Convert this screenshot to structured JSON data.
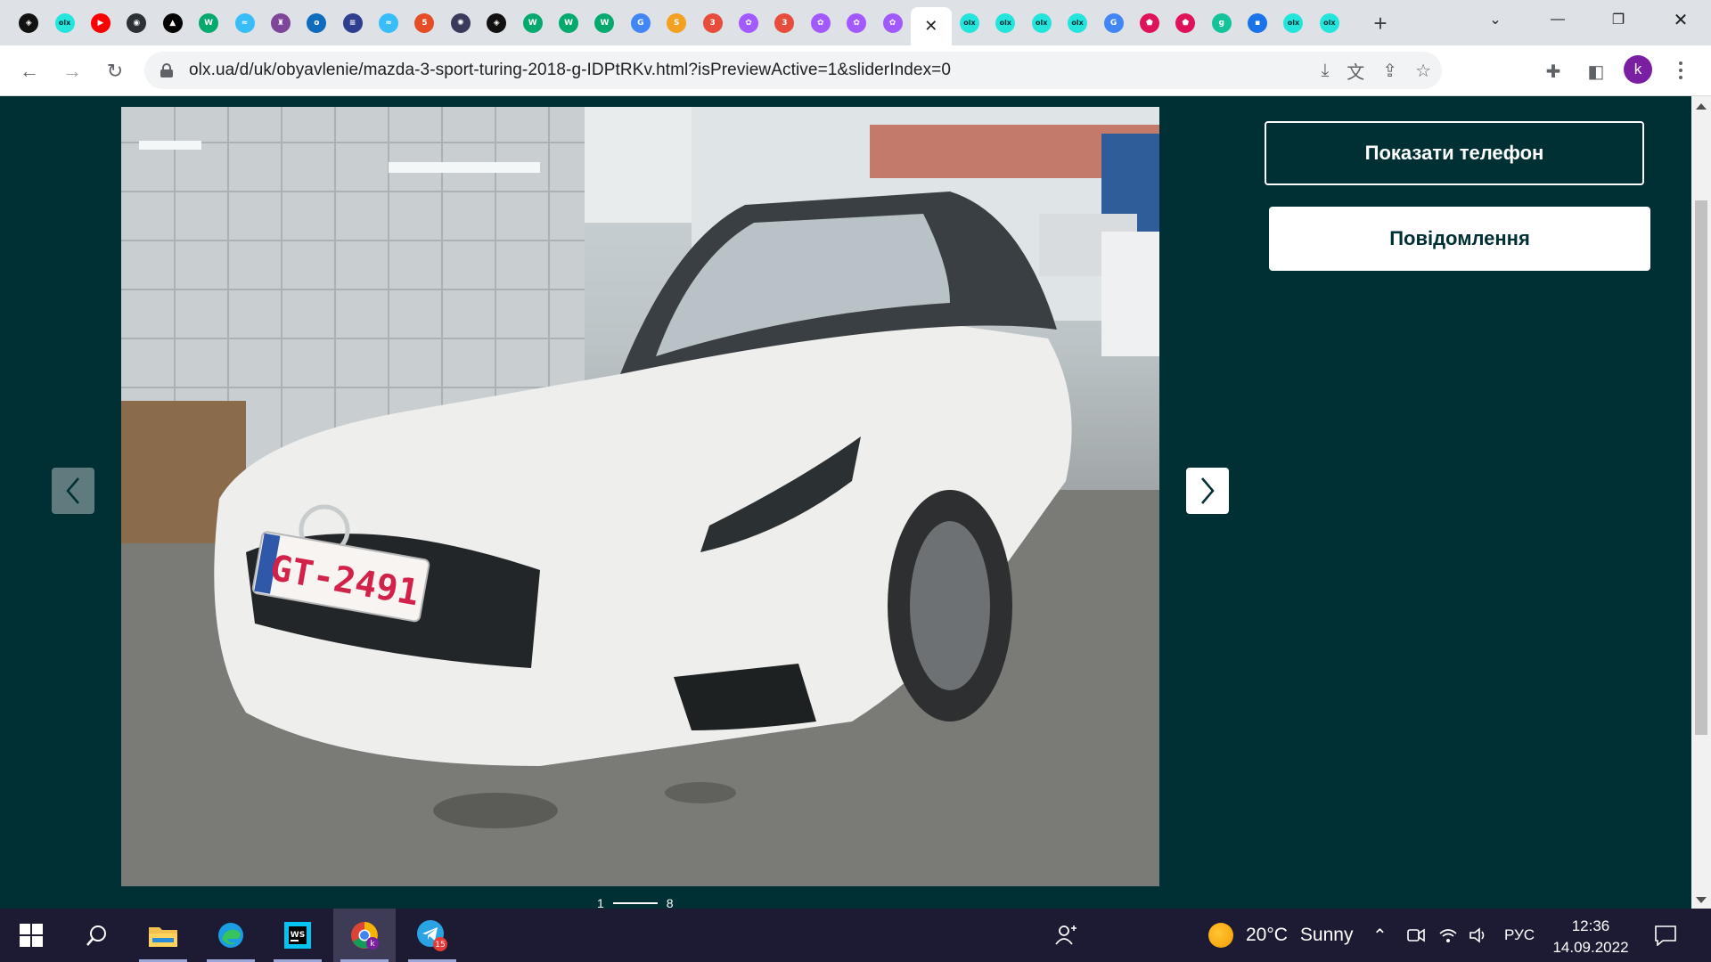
{
  "browser": {
    "tabs": [
      {
        "icon": "codepen-icon",
        "color": "#111111",
        "glyph": "◈"
      },
      {
        "icon": "olx-icon",
        "color": "#23e5db",
        "glyph": "olx"
      },
      {
        "icon": "youtube-icon",
        "color": "#ff0000",
        "glyph": "▶"
      },
      {
        "icon": "github-icon",
        "color": "#2b3137",
        "glyph": "◉"
      },
      {
        "icon": "vercel-icon",
        "color": "#000000",
        "glyph": "▲"
      },
      {
        "icon": "w3schools-icon",
        "color": "#04aa6d",
        "glyph": "W"
      },
      {
        "icon": "tailwind-icon",
        "color": "#38bdf8",
        "glyph": "≈"
      },
      {
        "icon": "tor-icon",
        "color": "#7d4698",
        "glyph": "♜"
      },
      {
        "icon": "outlook-icon",
        "color": "#0f6cbd",
        "glyph": "o"
      },
      {
        "icon": "stackoverflow-icon",
        "color": "#2f3f8f",
        "glyph": "≡"
      },
      {
        "icon": "tailwind-icon",
        "color": "#38bdf8",
        "glyph": "≈"
      },
      {
        "icon": "html5-icon",
        "color": "#e44d26",
        "glyph": "5"
      },
      {
        "icon": "app-icon",
        "color": "#3a3a5a",
        "glyph": "✺"
      },
      {
        "icon": "codepen-icon",
        "color": "#111111",
        "glyph": "◈"
      },
      {
        "icon": "w3schools-icon",
        "color": "#04aa6d",
        "glyph": "W"
      },
      {
        "icon": "w3schools-icon",
        "color": "#04aa6d",
        "glyph": "W"
      },
      {
        "icon": "w3schools-icon",
        "color": "#04aa6d",
        "glyph": "W"
      },
      {
        "icon": "google-icon",
        "color": "#4285f4",
        "glyph": "G"
      },
      {
        "icon": "sublime-icon",
        "color": "#f4a020",
        "glyph": "S"
      },
      {
        "icon": "badge-icon",
        "color": "#e74c3c",
        "glyph": "3"
      },
      {
        "icon": "figma-icon",
        "color": "#a259ff",
        "glyph": "✿"
      },
      {
        "icon": "badge-icon",
        "color": "#e74c3c",
        "glyph": "3"
      },
      {
        "icon": "figma-icon",
        "color": "#a259ff",
        "glyph": "✿"
      },
      {
        "icon": "figma-icon",
        "color": "#a259ff",
        "glyph": "✿"
      },
      {
        "icon": "figma-icon",
        "color": "#a259ff",
        "glyph": "✿"
      },
      {
        "icon": "close-icon",
        "color": "#202124",
        "glyph": "✕",
        "active": true
      },
      {
        "icon": "olx-icon",
        "color": "#23e5db",
        "glyph": "olx"
      },
      {
        "icon": "olx-icon",
        "color": "#23e5db",
        "glyph": "olx"
      },
      {
        "icon": "olx-icon",
        "color": "#23e5db",
        "glyph": "olx"
      },
      {
        "icon": "olx-icon",
        "color": "#23e5db",
        "glyph": "olx"
      },
      {
        "icon": "google-icon",
        "color": "#4285f4",
        "glyph": "G"
      },
      {
        "icon": "pink-icon",
        "color": "#e0125a",
        "glyph": "⬟"
      },
      {
        "icon": "pink-icon",
        "color": "#e0125a",
        "glyph": "⬟"
      },
      {
        "icon": "grammarly-icon",
        "color": "#15c39a",
        "glyph": "g"
      },
      {
        "icon": "chat-icon",
        "color": "#1a73e8",
        "glyph": "▪"
      },
      {
        "icon": "olx-icon",
        "color": "#23e5db",
        "glyph": "olx"
      },
      {
        "icon": "olx-icon",
        "color": "#23e5db",
        "glyph": "olx"
      }
    ],
    "url": "olx.ua/d/uk/obyavlenie/mazda-3-sport-turing-2018-g-IDPtRKv.html?isPreviewActive=1&sliderIndex=0",
    "profile_initial": "k"
  },
  "listing": {
    "phone_button": "Показати телефон",
    "message_button": "Повідомлення",
    "plate_text": "GT-2491",
    "pager_current": "1",
    "pager_total": "8"
  },
  "taskbar": {
    "weather_temp": "20°C",
    "weather_text": "Sunny",
    "language": "РУС",
    "time": "12:36",
    "date": "14.09.2022",
    "telegram_badge": "15",
    "chrome_profile": "k"
  },
  "colors": {
    "page_bg": "#002f34",
    "tabstrip_bg": "#dee1e6",
    "taskbar_bg": "#1d1b33"
  }
}
